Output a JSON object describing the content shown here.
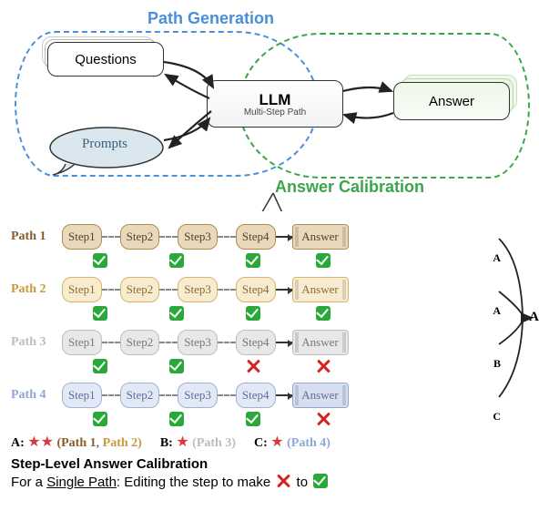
{
  "header": {
    "path_generation_label": "Path Generation",
    "answer_calibration_label": "Answer Calibration",
    "questions_box": "Questions",
    "llm_box": "LLM",
    "llm_subtitle": "Multi-Step Path",
    "answer_box": "Answer",
    "prompts_box": "Prompts"
  },
  "paths": [
    {
      "id": "path1",
      "label": "Path 1",
      "color": "#8a5a2b",
      "step_bg": "#e8d9bd",
      "step_border": "#b38b4d",
      "ans_bg": "#e8d9bd",
      "ans_border": "#b38b4d",
      "steps": [
        "Step1",
        "Step2",
        "Step3",
        "Step4"
      ],
      "marks": [
        "check",
        "check",
        "check",
        "check"
      ],
      "answer": "Answer",
      "answer_letter": "A"
    },
    {
      "id": "path2",
      "label": "Path 2",
      "color": "#c89a3a",
      "step_bg": "#f7ecd0",
      "step_border": "#d9b469",
      "ans_bg": "#f7ecd0",
      "ans_border": "#d9b469",
      "steps": [
        "Step1",
        "Step2",
        "Step3",
        "Step4"
      ],
      "marks": [
        "check",
        "check",
        "check",
        "check"
      ],
      "answer": "Answer",
      "answer_letter": "A"
    },
    {
      "id": "path3",
      "label": "Path 3",
      "color": "#bdbdbd",
      "step_bg": "#e8e8e8",
      "step_border": "#bfbfbf",
      "ans_bg": "#e8e8e8",
      "ans_border": "#bfbfbf",
      "steps": [
        "Step1",
        "Step2",
        "Step3",
        "Step4"
      ],
      "marks": [
        "check",
        "check",
        "cross",
        "cross"
      ],
      "answer": "Answer",
      "answer_letter": "B"
    },
    {
      "id": "path4",
      "label": "Path 4",
      "color": "#8ea7d6",
      "step_bg": "#e2e8f5",
      "step_border": "#9fb1d8",
      "ans_bg": "#d7def0",
      "ans_border": "#8ea7d6",
      "steps": [
        "Step1",
        "Step2",
        "Step3",
        "Step4"
      ],
      "marks": [
        "check",
        "check",
        "check",
        "cross"
      ],
      "answer": "Answer",
      "answer_letter": "C"
    }
  ],
  "final_vote": "A",
  "vote_summary": {
    "a_prefix": "A:",
    "a_paths": "(Path 1, Path 2)",
    "a_path1_color": "#8a5a2b",
    "a_path2_color": "#c89a3a",
    "b_prefix": "B:",
    "b_paths": "(Path 3)",
    "b_path_color": "#bdbdbd",
    "c_prefix": "C:",
    "c_paths": "(Path 4)",
    "c_path_color": "#8ea7d6"
  },
  "footer": {
    "title": "Step-Level Answer Calibration",
    "sentence_prefix": "For a ",
    "sentence_underline": "Single Path",
    "sentence_mid": ": Editing the step to make ",
    "sentence_to": " to "
  }
}
